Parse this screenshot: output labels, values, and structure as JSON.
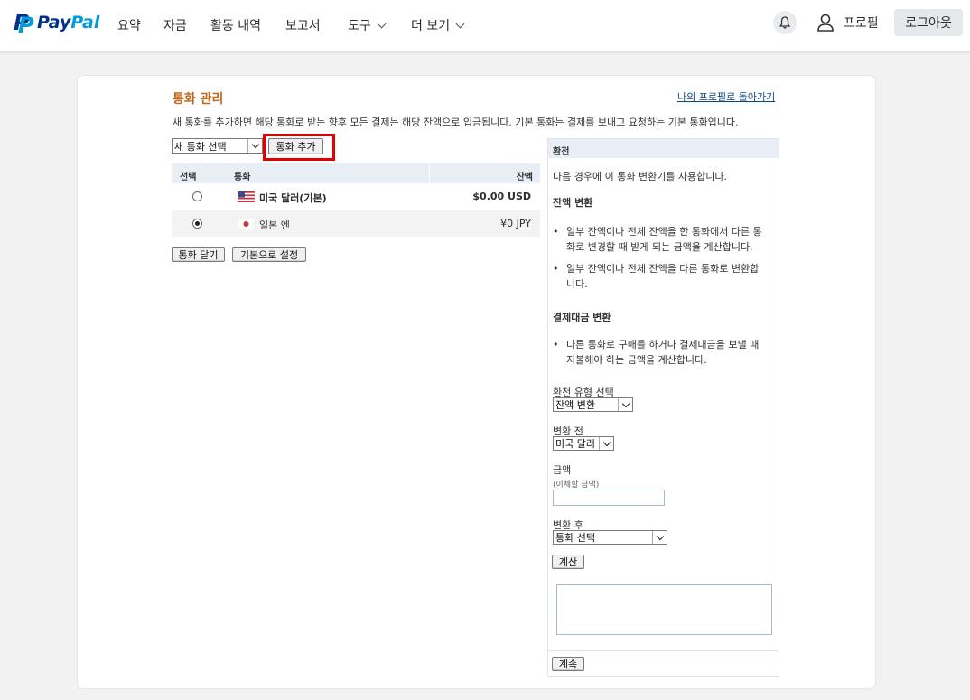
{
  "brand": {
    "pay": "Pay",
    "pal": "Pal",
    "primary": "#003087",
    "secondary": "#009cde"
  },
  "nav": {
    "summary": "요약",
    "funds": "자금",
    "activity": "활동 내역",
    "reports": "보고서",
    "tools": "도구",
    "more": "더 보기"
  },
  "header": {
    "profile": "프로필",
    "logout": "로그아웃"
  },
  "page": {
    "title": "통화 관리",
    "back_link": "나의 프로필로 돌아가기",
    "intro": "새 통화를 추가하면 해당 통화로 받는 향후 모든 결제는 해당 잔액으로 입금됩니다. 기본 통화는 결제를 보내고 요청하는 기본 통화입니다.",
    "new_currency_select": "새 통화 선택",
    "add_currency_button": "통화 추가"
  },
  "table": {
    "headers": {
      "select": "선택",
      "currency": "통화",
      "balance": "잔액"
    },
    "rows": [
      {
        "name": "미국 달러(기본)",
        "balance": "$0.00 USD",
        "selected": false,
        "flag": "us-flag"
      },
      {
        "name": "일본 엔",
        "balance": "¥0 JPY",
        "selected": true,
        "flag": "jp-flag"
      }
    ]
  },
  "actions": {
    "close_currency": "통화 닫기",
    "set_default": "기본으로 설정"
  },
  "converter": {
    "title": "환전",
    "intro": "다음 경우에 이 통화 변환기를 사용합니다.",
    "balance_section": "잔액 변환",
    "balance_bullets": [
      "일부 잔액이나 전체 잔액을 한 통화에서 다른 통화로 변경할 때 받게 되는 금액을 계산합니다.",
      "일부 잔액이나 전체 잔액을 다른 통화로 변환합니다."
    ],
    "payment_section": "결제대금 변환",
    "payment_bullets": [
      "다른 통화로 구매를 하거나 결제대금을 보낼 때 지불해야 하는 금액을 계산합니다."
    ],
    "type_label": "환전 유형 선택",
    "type_value": "잔액 변환",
    "from_label": "변환 전",
    "from_value": "미국 달러",
    "amount_label": "금액",
    "amount_hint": "(이체할 금액)",
    "amount_value": "",
    "to_label": "변환 후",
    "to_value": "통화 선택",
    "calculate_button": "계산",
    "continue_button": "계속"
  },
  "colors": {
    "title": "#c16718",
    "link": "#084482",
    "highlight": "#e30000"
  }
}
